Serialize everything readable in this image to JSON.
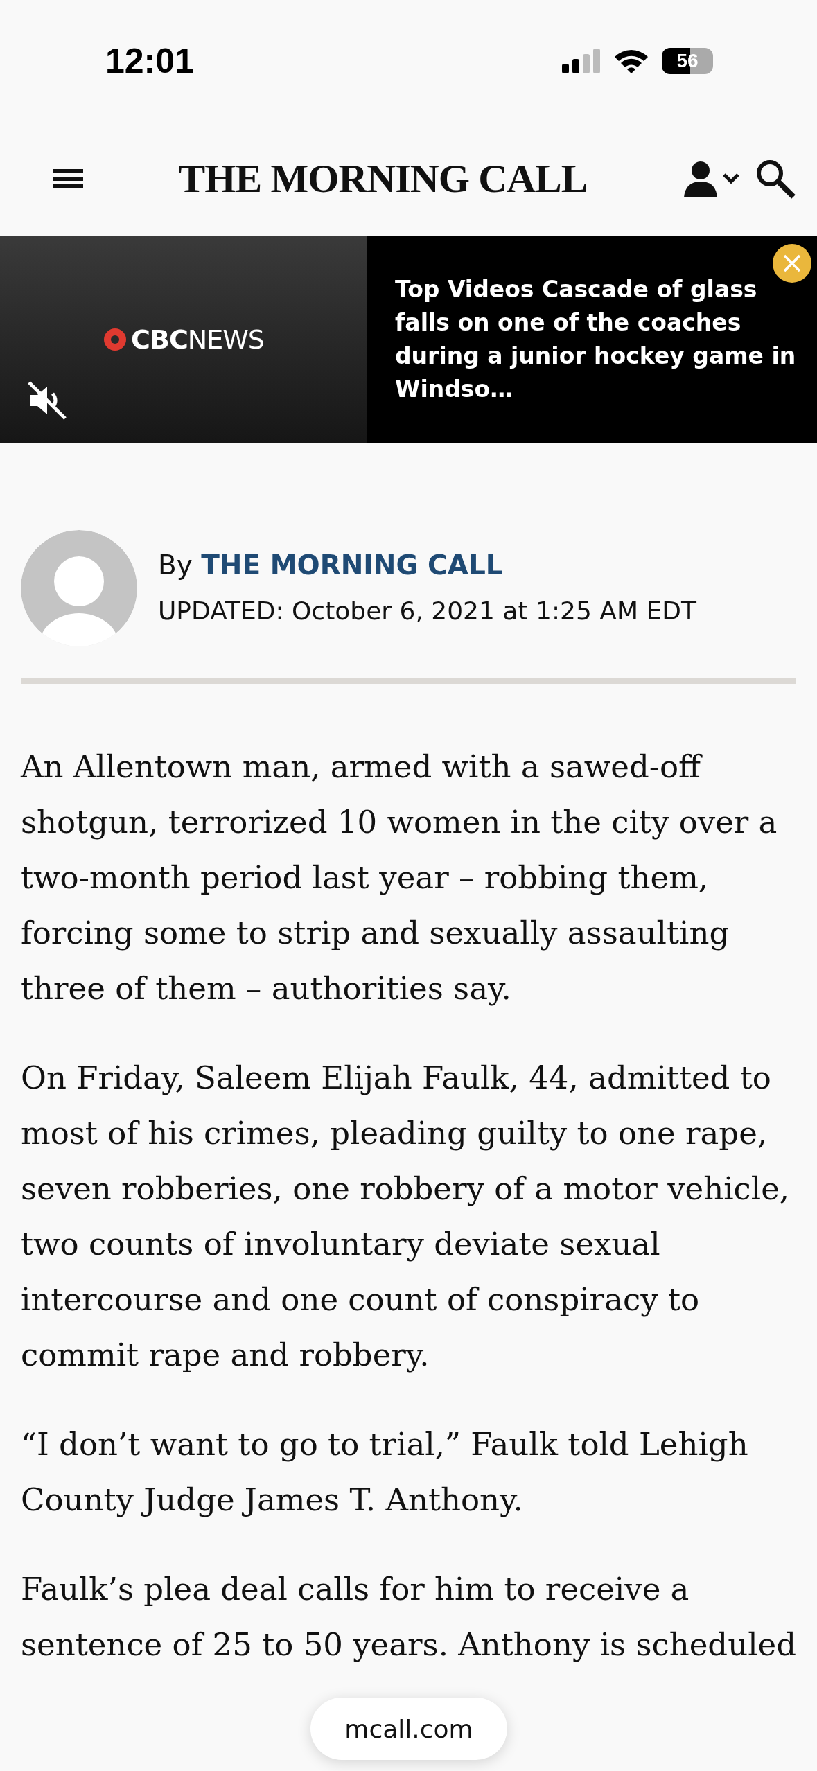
{
  "status_bar": {
    "time": "12:01",
    "battery": "56"
  },
  "header": {
    "logo": "THE MORNING CALL"
  },
  "video": {
    "brand_bold": "CBC",
    "brand_light": "NEWS",
    "caption": "Top Videos Cascade of glass falls on one of the coaches during a junior hockey game in Windso…",
    "muted": true
  },
  "byline": {
    "prefix": "By",
    "author": "THE MORNING CALL",
    "updated": "UPDATED: October 6, 2021 at 1:25 AM EDT"
  },
  "paragraphs": [
    "An Allentown man, armed with a sawed-off shotgun, terrorized 10 women in the city over a two-month period last year – robbing them, forcing some to strip and sexually assaulting three of them – authorities say.",
    "On Friday, Saleem Elijah Faulk, 44, admitted to most of his crimes, pleading guilty to one rape, seven robberies, one robbery of a motor vehicle, two counts of involuntary deviate sexual intercourse and one count of conspiracy to commit rape and robbery.",
    "“I don’t want to go to trial,” Faulk told Lehigh County Judge James T. Anthony.",
    "Faulk’s plea deal calls for him to receive a sentence of 25 to 50 years. Anthony is scheduled"
  ],
  "address_bar": {
    "url": "mcall.com"
  }
}
